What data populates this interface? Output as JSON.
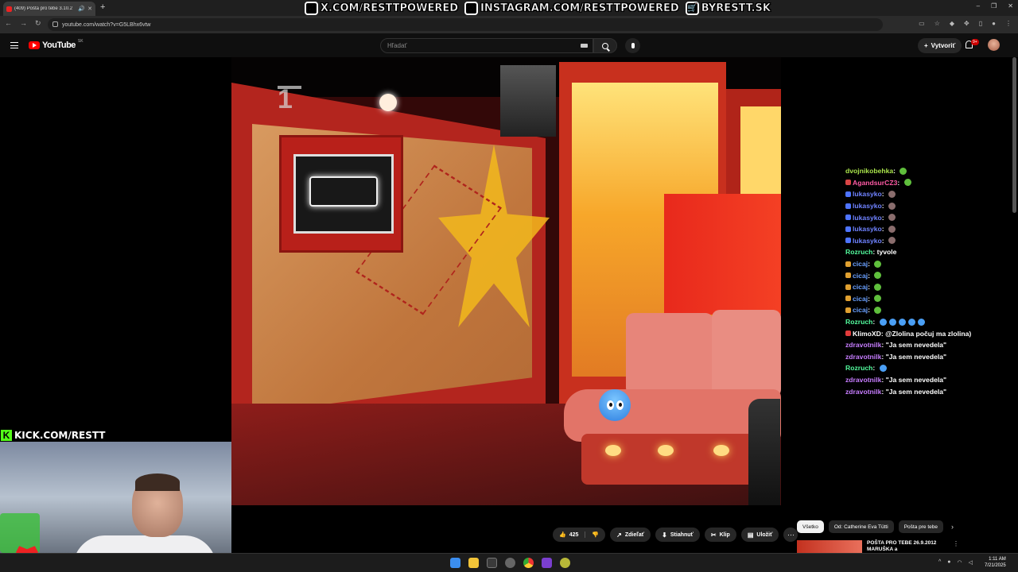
{
  "browser": {
    "tab_title": "(409) Pošta pro tebe 3.10.2",
    "url": "youtube.com/watch?v=G5LBhx6vtw",
    "new_tab": "+",
    "win_min": "–",
    "win_max": "❐",
    "win_close": "✕"
  },
  "banner": {
    "x": "X.COM/RESTTPOWERED",
    "instagram": "INSTAGRAM.COM/RESTTPOWERED",
    "shop": "BYRESTT.SK"
  },
  "youtube": {
    "logo_text": "YouTube",
    "country": "SK",
    "search_placeholder": "Hľadať",
    "create_label": "Vytvoriť",
    "notif_count": "9+"
  },
  "video": {
    "channel_mark": "1"
  },
  "chat": [
    {
      "user": "dvojnikobehka",
      "msg": "",
      "color": "#a9e34b",
      "badge": "",
      "emote": "#5fbf3c"
    },
    {
      "user": "AgandsurCZ3",
      "msg": "",
      "color": "#ff5aa5",
      "badge": "#d94545",
      "emote": "#5fbf3c"
    },
    {
      "user": "lukasyko",
      "msg": "",
      "color": "#6f82ff",
      "badge": "#4e74ff",
      "emote": "#8a6d6d"
    },
    {
      "user": "lukasyko",
      "msg": "",
      "color": "#6f82ff",
      "badge": "#4e74ff",
      "emote": "#8a6d6d"
    },
    {
      "user": "lukasyko",
      "msg": "",
      "color": "#6f82ff",
      "badge": "#4e74ff",
      "emote": "#8a6d6d"
    },
    {
      "user": "lukasyko",
      "msg": "",
      "color": "#6f82ff",
      "badge": "#4e74ff",
      "emote": "#8a6d6d"
    },
    {
      "user": "lukasyko",
      "msg": "",
      "color": "#6f82ff",
      "badge": "#4e74ff",
      "emote": "#8a6d6d"
    },
    {
      "user": "Rozruch",
      "msg": "tyvole",
      "color": "#53fc9e",
      "badge": "",
      "emote": ""
    },
    {
      "user": "cicaj",
      "msg": "",
      "color": "#6aa0ff",
      "badge": "#e0a030",
      "emote": "#5fbf3c"
    },
    {
      "user": "cicaj",
      "msg": "",
      "color": "#6aa0ff",
      "badge": "#e0a030",
      "emote": "#5fbf3c"
    },
    {
      "user": "cicaj",
      "msg": "",
      "color": "#6aa0ff",
      "badge": "#e0a030",
      "emote": "#5fbf3c"
    },
    {
      "user": "cicaj",
      "msg": "",
      "color": "#6aa0ff",
      "badge": "#e0a030",
      "emote": "#5fbf3c"
    },
    {
      "user": "cicaj",
      "msg": "",
      "color": "#6aa0ff",
      "badge": "#e0a030",
      "emote": "#5fbf3c"
    },
    {
      "user": "Rozruch",
      "msg": "",
      "color": "#53fc9e",
      "badge": "",
      "emote": "#4a9ff5"
    },
    {
      "user": "KlimoXD",
      "msg": "@Zlolina počuj ma zlolina)",
      "color": "#ffffff",
      "badge": "#e23b3b",
      "emote": ""
    },
    {
      "user": "zdravotnilk",
      "msg": "\"Ja sem nevedela\"",
      "color": "#c77dff",
      "badge": "",
      "emote": ""
    },
    {
      "user": "zdravotnilk",
      "msg": "\"Ja sem nevedela\"",
      "color": "#c77dff",
      "badge": "",
      "emote": ""
    },
    {
      "user": "Rozruch",
      "msg": "",
      "color": "#53fc9e",
      "badge": "",
      "emote": "#4a9ff5"
    },
    {
      "user": "zdravotnilk",
      "msg": "\"Ja sem nevedela\"",
      "color": "#c77dff",
      "badge": "",
      "emote": ""
    },
    {
      "user": "zdravotnilk",
      "msg": "\"Ja sem nevedela\"",
      "color": "#c77dff",
      "badge": "",
      "emote": ""
    }
  ],
  "actions": {
    "likes": "425",
    "share": "Zdieľať",
    "download": "Stiahnuť",
    "clip": "Klip",
    "save": "Uložiť",
    "more": "···"
  },
  "chips": {
    "all": "Všetko",
    "from": "Od: Catherine Eva Tütti",
    "related": "Pošta pre tebe"
  },
  "recommendation": {
    "title": "POŠTA PRO TEBE 26.9.2012 MARUŠKA a"
  },
  "webcam": {
    "kick_label": "KICK.COM/RESTT"
  },
  "taskbar": {
    "time": "1:11 AM",
    "date": "7/21/2025"
  }
}
